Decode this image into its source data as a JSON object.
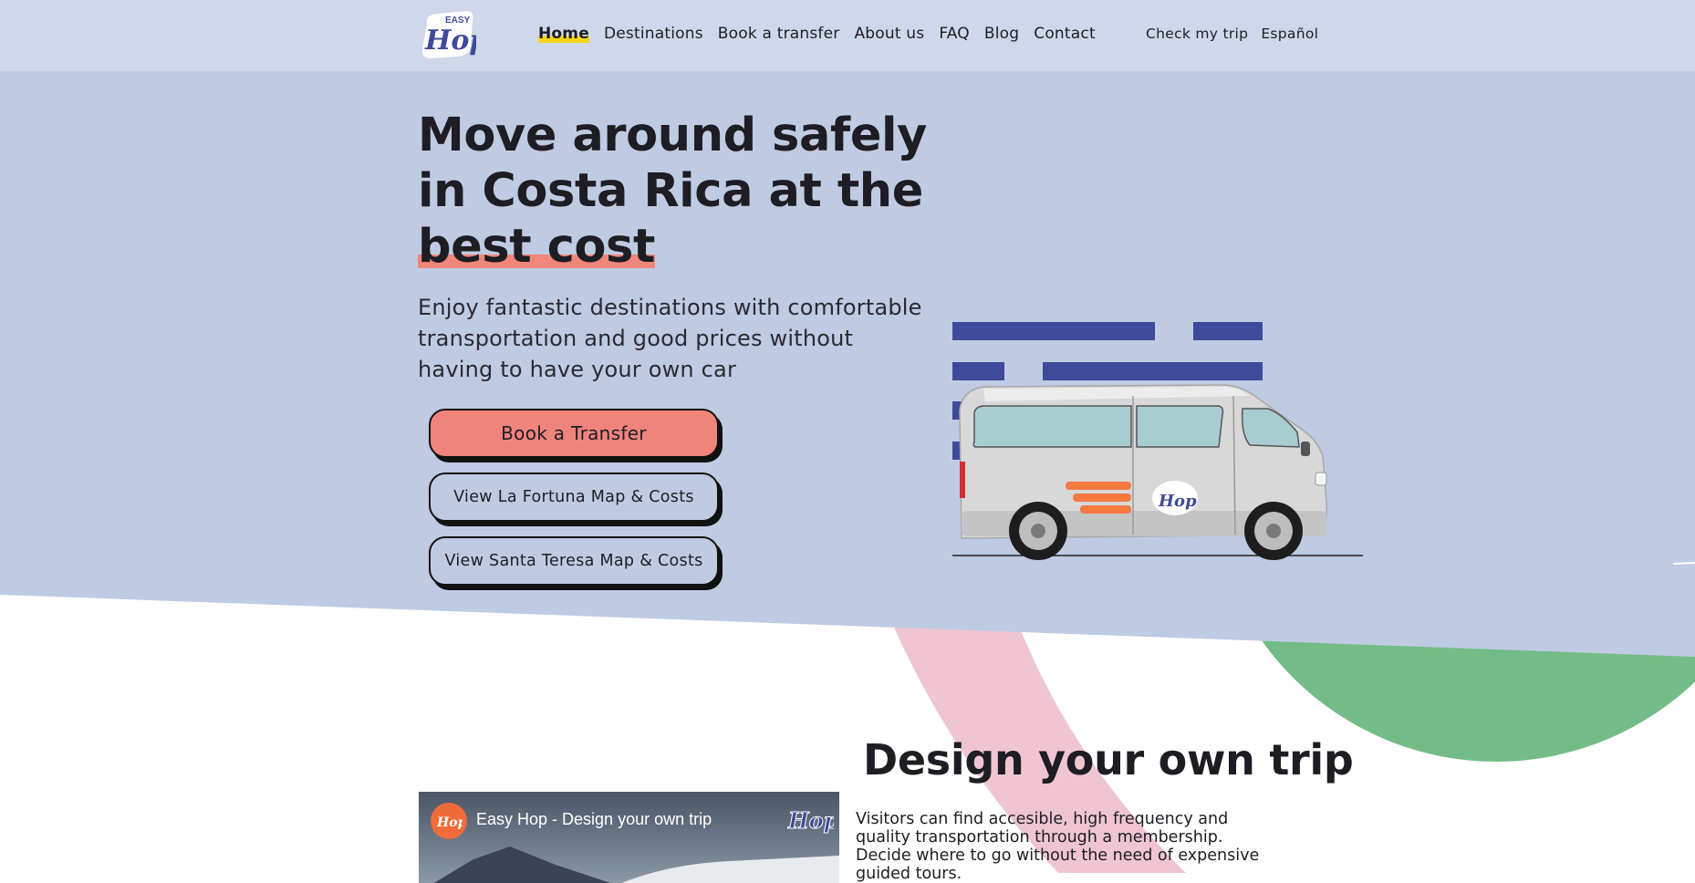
{
  "brand": {
    "name": "Easy Hop",
    "logo_top_text": "EASY",
    "logo_main_text": "Hop",
    "colors": {
      "navy": "#3f4a9a",
      "coral": "#f0847c",
      "header_bg": "#cfd8ea",
      "hero_bg": "#bfcbe2",
      "pink": "#efc5d2",
      "green": "#73bc87",
      "highlight_yellow": "#f6d51c",
      "van_stripe_orange": "#f47a42"
    }
  },
  "nav": {
    "items": [
      {
        "label": "Home",
        "active": true
      },
      {
        "label": "Destinations"
      },
      {
        "label": "Book a transfer"
      },
      {
        "label": "About us"
      },
      {
        "label": "FAQ"
      },
      {
        "label": "Blog"
      },
      {
        "label": "Contact"
      }
    ],
    "check_trip": "Check my trip",
    "language": "Español"
  },
  "hero": {
    "title_part1": "Move around safely in Costa Rica at the ",
    "title_highlight": "best cost",
    "subtitle": "Enjoy fantastic destinations with comfortable transportation and good prices without having to have your own car",
    "buttons": {
      "book": "Book a Transfer",
      "la_fortuna": "View La Fortuna Map & Costs",
      "santa_teresa": "View Santa Teresa Map & Costs"
    },
    "van_illustration": "easy-hop-van"
  },
  "design": {
    "title": "Design your own trip",
    "text": "Visitors can find accesible, high frequency and quality transportation through a membership. Decide where to go without the need of expensive guided tours.",
    "video": {
      "title": "Easy Hop - Design your own trip"
    }
  }
}
